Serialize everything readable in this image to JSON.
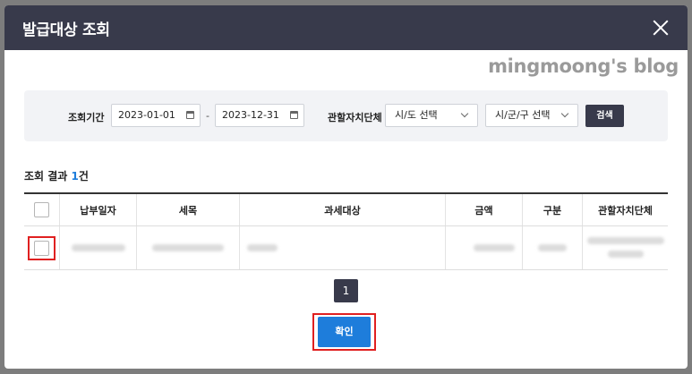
{
  "modal": {
    "title": "발급대상 조회"
  },
  "watermark": "mingmoong's blog",
  "filter": {
    "period_label": "조회기간",
    "start_date": "2023-01-01",
    "separator": "-",
    "end_date": "2023-12-31",
    "region_label": "관할자치단체",
    "city_select": "시/도 선택",
    "district_select": "시/군/구 선택",
    "search_label": "검색"
  },
  "results": {
    "prefix": "조회 결과 ",
    "count": "1",
    "suffix": "건",
    "columns": [
      "납부일자",
      "세목",
      "과세대상",
      "금액",
      "구분",
      "관할자치단체"
    ]
  },
  "pagination": {
    "current_page": "1"
  },
  "confirm_label": "확인",
  "colors": {
    "header_bg": "#383a4b",
    "accent_blue": "#1e7ddb",
    "highlight_red": "#e02020"
  }
}
